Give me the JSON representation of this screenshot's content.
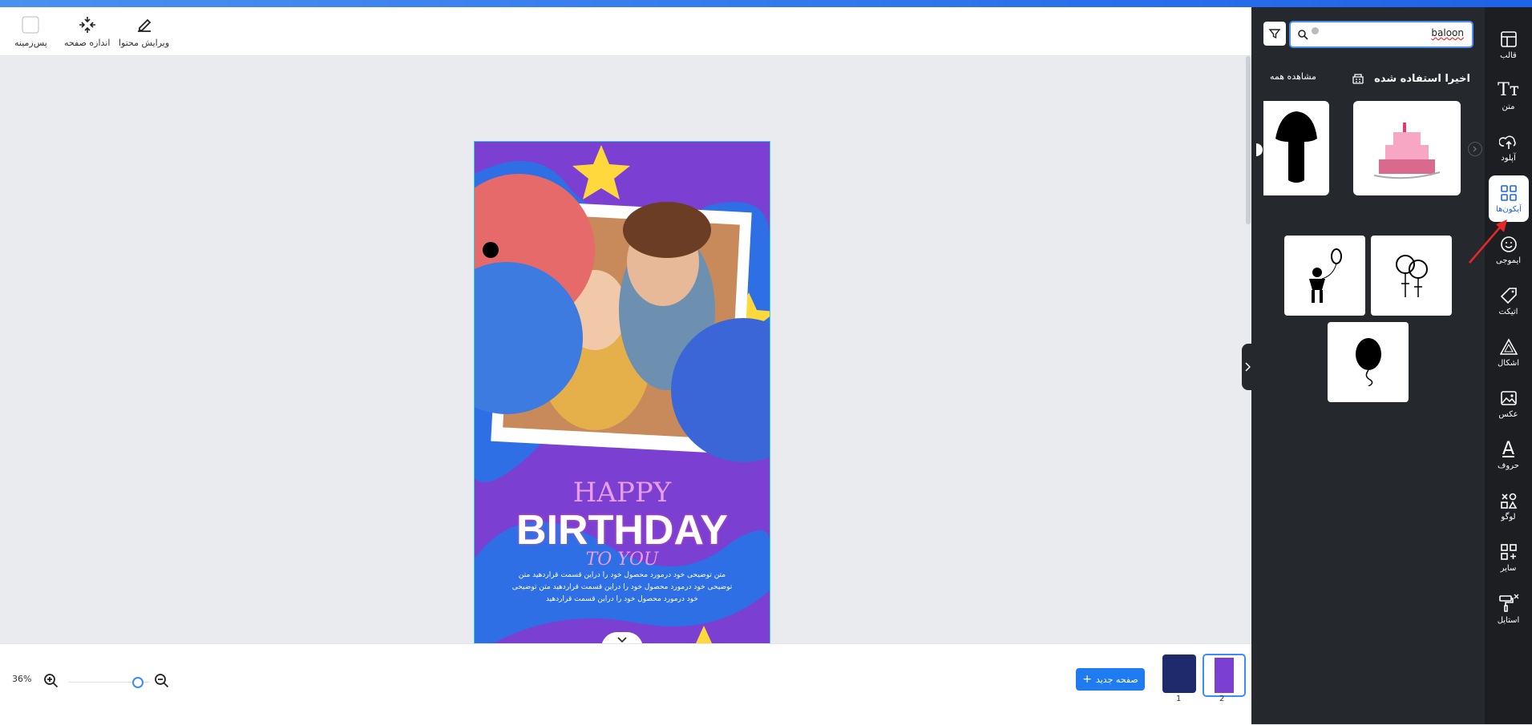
{
  "toolbar": {
    "background_label": "پس‌زمینه",
    "page_size_label": "اندازه صفحه",
    "edit_content_label": "ویرایش محتوا"
  },
  "design": {
    "happy": "HAPPY",
    "birthday": "BIRTHDAY",
    "to_you": "TO YOU",
    "body_text": "متن توضیحی خود درمورد محصول خود را دراین قسمت قراردهید متن توضیحی خود درمورد محصول خود را دراین قسمت قراردهید متن توضیحی خود درمورد محصول خود را دراین قسمت قراردهید"
  },
  "bottom": {
    "zoom_label": "36%",
    "zoom_level": 0.36,
    "new_page_label": "صفحه جدید",
    "pages": [
      "1",
      "2"
    ]
  },
  "panel": {
    "search_value": "baloon",
    "recent_label": "اخیرا استفاده شده",
    "view_all_label": "مشاهده همه"
  },
  "rail": {
    "items": [
      "قالب",
      "متن",
      "آپلود",
      "آیکون‌ها",
      "ایموجی",
      "اتیکت",
      "اشکال",
      "عکس",
      "حروف",
      "لوگو",
      "سایر",
      "استایل"
    ]
  },
  "colors": {
    "accent": "#1e63e8",
    "card_purple": "#7b3fd1",
    "panel_dark": "#25282d"
  }
}
